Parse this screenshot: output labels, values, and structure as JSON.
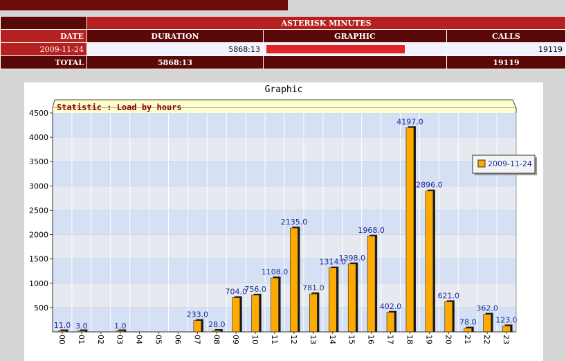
{
  "table": {
    "title": "ASTERISK MINUTES",
    "headers": {
      "date": "DATE",
      "duration": "DURATION",
      "graphic": "GRAPHIC",
      "calls": "CALLS"
    },
    "rows": [
      {
        "date": "2009-11-24",
        "duration": "5868:13",
        "graphic_fraction": 1.0,
        "calls": "19119"
      }
    ],
    "total": {
      "label": "TOTAL",
      "duration": "5868:13",
      "calls": "19119"
    }
  },
  "chart": {
    "title": "Graphic",
    "subtitle": "Statistic : Load by hours",
    "legend": "2009-11-24"
  },
  "chart_data": {
    "type": "bar",
    "title": "Graphic",
    "subtitle": "Statistic : Load by hours",
    "categories": [
      "00",
      "01",
      "02",
      "03",
      "04",
      "05",
      "06",
      "07",
      "08",
      "09",
      "10",
      "11",
      "12",
      "13",
      "14",
      "15",
      "16",
      "17",
      "18",
      "19",
      "20",
      "21",
      "22",
      "23"
    ],
    "series": [
      {
        "name": "2009-11-24",
        "values": [
          11.0,
          3.0,
          0,
          1.0,
          0,
          0,
          0,
          233.0,
          28.0,
          704.0,
          756.0,
          1108.0,
          2135.0,
          781.0,
          1314.0,
          1398.0,
          1968.0,
          402.0,
          4197.0,
          2896.0,
          621.0,
          78.0,
          362.0,
          123.0
        ]
      }
    ],
    "data_labels": [
      "11.0",
      "3.0",
      "",
      "1.0",
      "",
      "",
      "",
      "233.0",
      "28.0",
      "704.0",
      "756.0",
      "1108.0",
      "2135.0",
      "781.0",
      "1314.0",
      "1398.0",
      "1968.0",
      "402.0",
      "4197.0",
      "2896.0",
      "621.0",
      "78.0",
      "362.0",
      "123.0"
    ],
    "yticks": [
      500,
      1000,
      1500,
      2000,
      2500,
      3000,
      3500,
      4000,
      4500
    ],
    "ylim": [
      0,
      4500
    ],
    "grid": true,
    "legend_position": "right",
    "colors": {
      "bar": "#ffaa00",
      "bar_shadow": "#1a1a1a",
      "label": "#1a2a9a",
      "title_bg": "#ffffcc",
      "plot_band_a": "#d6e0f5",
      "plot_band_b": "#e6eaf0"
    }
  }
}
